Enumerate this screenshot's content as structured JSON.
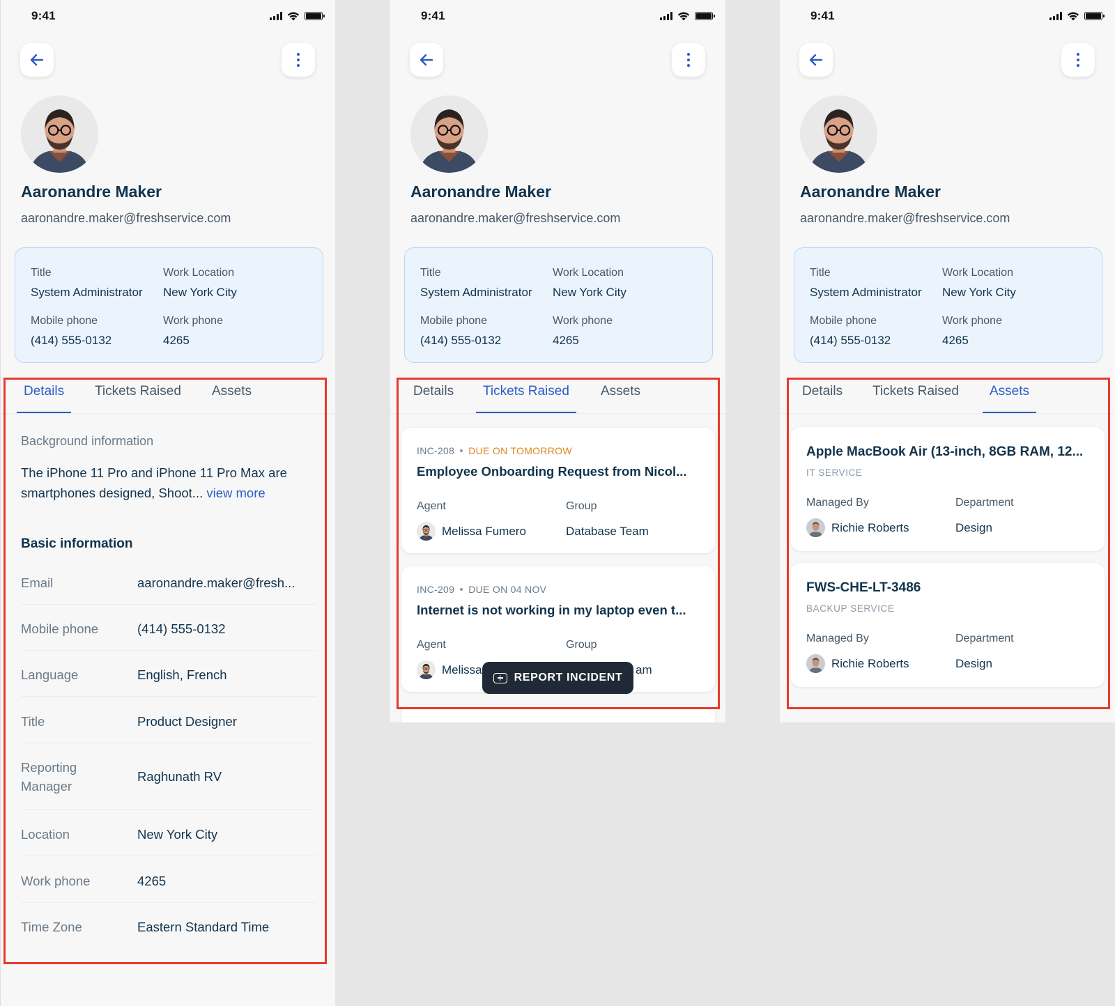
{
  "colors": {
    "accent": "#2c5cc5",
    "highlight": "#e8392b",
    "due_warning": "#e0861a",
    "button_dark": "#1f2a36"
  },
  "status": {
    "time": "9:41"
  },
  "profile": {
    "name": "Aaronandre Maker",
    "email": "aaronandre.maker@freshservice.com",
    "card": {
      "title_label": "Title",
      "title_value": "System Administrator",
      "location_label": "Work Location",
      "location_value": "New York City",
      "mobile_label": "Mobile phone",
      "mobile_value": "(414) 555-0132",
      "workphone_label": "Work phone",
      "workphone_value": "4265"
    }
  },
  "tabs": {
    "details": "Details",
    "tickets": "Tickets Raised",
    "assets": "Assets"
  },
  "details": {
    "background_label": "Background information",
    "background_text": "The iPhone 11 Pro and iPhone 11 Pro Max are smartphones designed, Shoot...",
    "view_more": "view more",
    "basic_title": "Basic information",
    "rows": [
      {
        "k": "Email",
        "v": "aaronandre.maker@fresh..."
      },
      {
        "k": "Mobile phone",
        "v": "(414) 555-0132"
      },
      {
        "k": "Language",
        "v": "English, French"
      },
      {
        "k": "Title",
        "v": "Product Designer"
      },
      {
        "k": "Reporting Manager",
        "v": "Raghunath RV"
      },
      {
        "k": "Location",
        "v": "New York City"
      },
      {
        "k": "Work phone",
        "v": "4265"
      },
      {
        "k": "Time Zone",
        "v": "Eastern Standard Time"
      }
    ]
  },
  "tickets": [
    {
      "id": "INC-208",
      "due": "DUE ON TOMORROW",
      "title": "Employee Onboarding Request from Nicol...",
      "agent_label": "Agent",
      "agent": "Melissa Fumero",
      "group_label": "Group",
      "group": "Database Team"
    },
    {
      "id": "INC-209",
      "due": "DUE ON 04 NOV",
      "title": "Internet is not working in my laptop even t...",
      "agent_label": "Agent",
      "agent": "Melissa",
      "group_label": "Group",
      "group": "am"
    }
  ],
  "report_button": "REPORT INCIDENT",
  "assets": [
    {
      "title": "Apple MacBook Air (13-inch, 8GB RAM, 12...",
      "service": "IT SERVICE",
      "managed_label": "Managed By",
      "managed": "Richie Roberts",
      "dept_label": "Department",
      "dept": "Design"
    },
    {
      "title": "FWS-CHE-LT-3486",
      "service": "BACKUP SERVICE",
      "managed_label": "Managed By",
      "managed": "Richie Roberts",
      "dept_label": "Department",
      "dept": "Design"
    }
  ]
}
